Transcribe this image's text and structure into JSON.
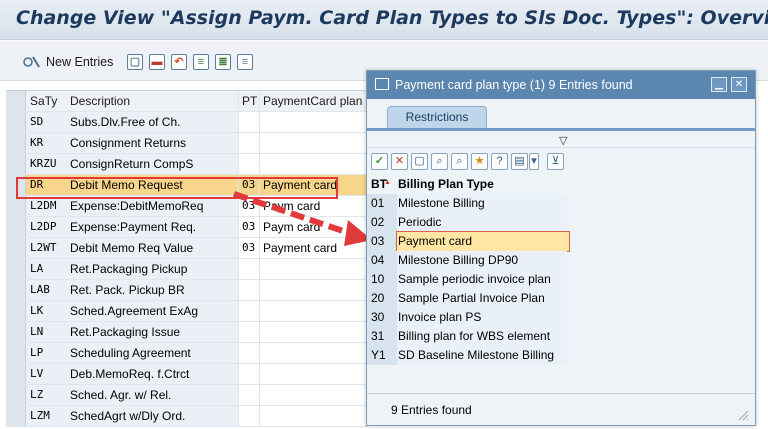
{
  "window": {
    "title": "Change View \"Assign Paym. Card Plan Types to Sls Doc. Types\": Overview"
  },
  "toolbar": {
    "new_entries_label": "New Entries",
    "icons": [
      "display-change-icon",
      "copy-icon",
      "delete-icon",
      "undo-icon",
      "select-all-icon",
      "select-block-icon",
      "deselect-all-icon"
    ]
  },
  "table": {
    "headers": [
      "SaTy",
      "Description",
      "PT",
      "PaymentCard plan"
    ],
    "rows": [
      {
        "saty": "SD",
        "desc": "Subs.Dlv.Free of Ch.",
        "pt": "",
        "pcp": ""
      },
      {
        "saty": "KR",
        "desc": "Consignment Returns",
        "pt": "",
        "pcp": ""
      },
      {
        "saty": "KRZU",
        "desc": "ConsignReturn CompS",
        "pt": "",
        "pcp": ""
      },
      {
        "saty": "DR",
        "desc": "Debit Memo Request",
        "pt": "03",
        "pcp": "Payment card"
      },
      {
        "saty": "L2DM",
        "desc": "Expense:DebitMemoReq",
        "pt": "03",
        "pcp": "Paym   card"
      },
      {
        "saty": "L2DP",
        "desc": "Expense:Payment Req.",
        "pt": "03",
        "pcp": "Paym   card"
      },
      {
        "saty": "L2WT",
        "desc": "Debit Memo Req Value",
        "pt": "03",
        "pcp": "Payment card"
      },
      {
        "saty": "LA",
        "desc": "Ret.Packaging Pickup",
        "pt": "",
        "pcp": ""
      },
      {
        "saty": "LAB",
        "desc": "Ret. Pack. Pickup BR",
        "pt": "",
        "pcp": ""
      },
      {
        "saty": "LK",
        "desc": "Sched.Agreement ExAg",
        "pt": "",
        "pcp": ""
      },
      {
        "saty": "LN",
        "desc": "Ret.Packaging Issue",
        "pt": "",
        "pcp": ""
      },
      {
        "saty": "LP",
        "desc": "Scheduling Agreement",
        "pt": "",
        "pcp": ""
      },
      {
        "saty": "LV",
        "desc": "Deb.MemoReq. f.Ctrct",
        "pt": "",
        "pcp": ""
      },
      {
        "saty": "LZ",
        "desc": "Sched. Agr. w/ Rel.",
        "pt": "",
        "pcp": ""
      },
      {
        "saty": "LZM",
        "desc": "SchedAgrt w/Dly Ord.",
        "pt": "",
        "pcp": ""
      }
    ]
  },
  "popup": {
    "title": "Payment card plan type (1)   9 Entries found",
    "tab": "Restrictions",
    "headers": {
      "code": "BT",
      "text": "Billing Plan Type"
    },
    "items": [
      {
        "code": "01",
        "text": "Milestone Billing"
      },
      {
        "code": "02",
        "text": "Periodic"
      },
      {
        "code": "03",
        "text": "Payment card"
      },
      {
        "code": "04",
        "text": "Milestone Billing DP90"
      },
      {
        "code": "10",
        "text": "Sample periodic invoice plan"
      },
      {
        "code": "20",
        "text": "Sample Partial Invoice Plan"
      },
      {
        "code": "30",
        "text": "Invoice plan PS"
      },
      {
        "code": "31",
        "text": "Billing plan for WBS element"
      },
      {
        "code": "Y1",
        "text": "SD Baseline Milestone Billing"
      }
    ],
    "footer": "9 Entries found"
  },
  "colors": {
    "highlight": "#f7d58a",
    "annotation_red": "#e03a3a",
    "popup_title": "#5b86b0"
  }
}
